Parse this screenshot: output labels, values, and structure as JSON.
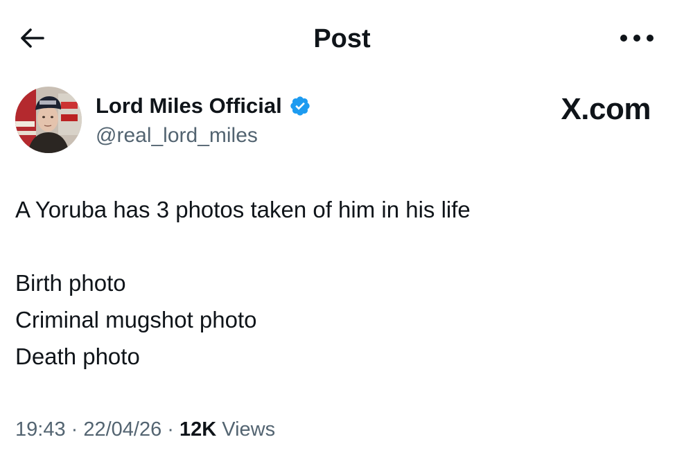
{
  "header": {
    "title": "Post",
    "back_icon": "arrow-left-icon",
    "more_icon": "more-horizontal-icon"
  },
  "author": {
    "name": "Lord Miles Official",
    "handle": "@real_lord_miles",
    "verified": true,
    "verified_color": "#1d9bf0",
    "avatar_icon": "avatar-photo"
  },
  "watermark": "X.com",
  "tweet": {
    "line1": "A Yoruba has 3 photos taken of him in his life",
    "line2": "Birth photo",
    "line3": "Criminal mugshot photo",
    "line4": "Death photo"
  },
  "meta": {
    "time": "19:43",
    "separator": " · ",
    "date": "22/04/26",
    "views_count": "12K",
    "views_label": " Views"
  },
  "colors": {
    "text_primary": "#0f1419",
    "text_secondary": "#536471",
    "accent": "#1d9bf0"
  }
}
